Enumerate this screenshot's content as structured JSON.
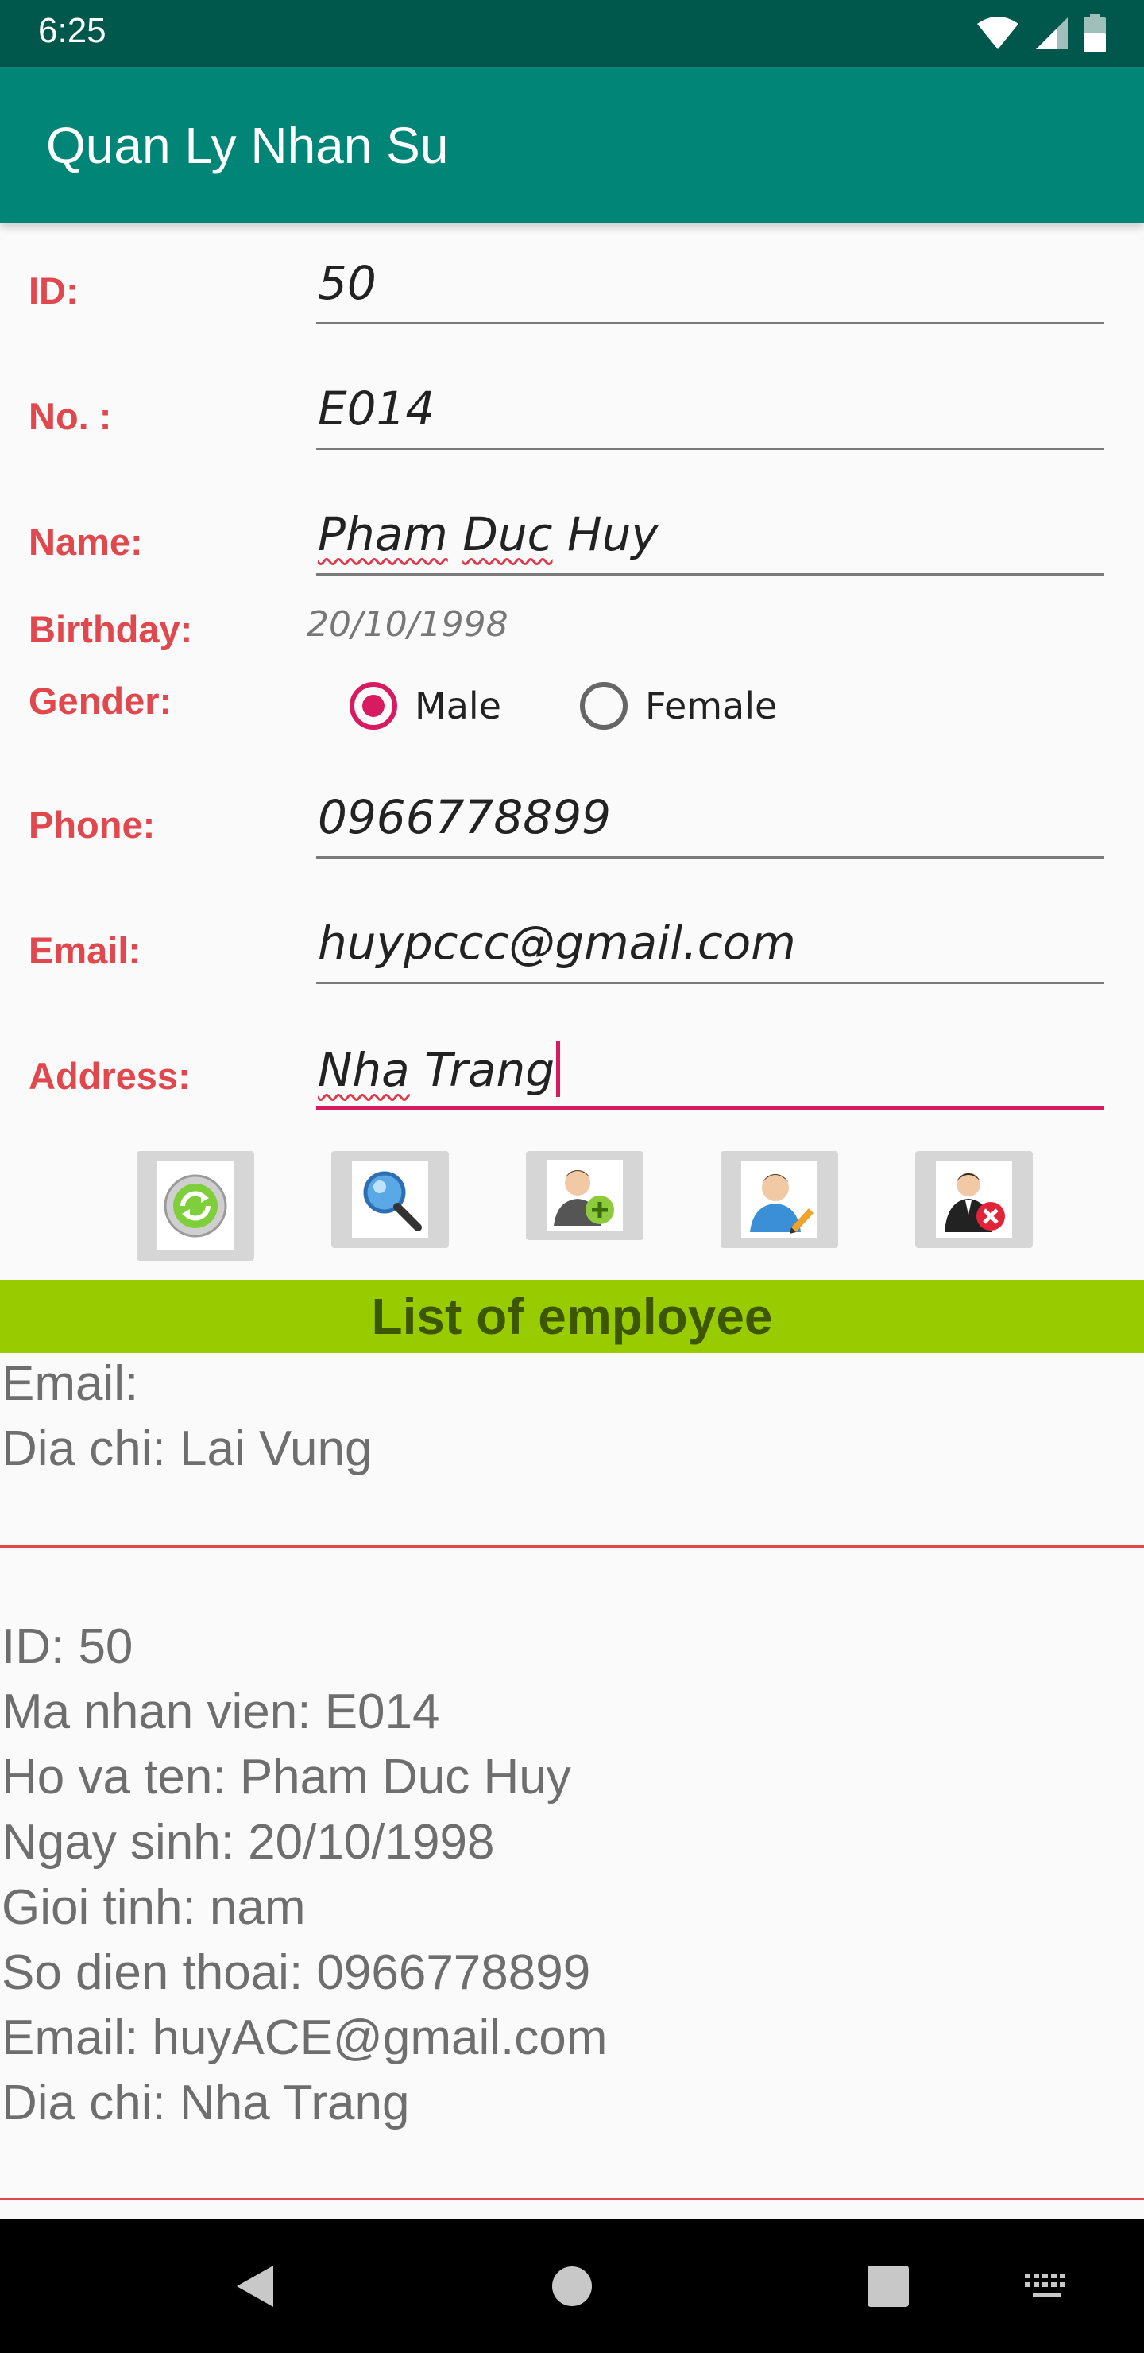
{
  "status_bar": {
    "time": "6:25",
    "icons": [
      "wifi-icon",
      "signal-icon",
      "battery-icon"
    ]
  },
  "app_bar": {
    "title": "Quan Ly Nhan Su"
  },
  "form": {
    "id_label": "ID:",
    "id_value": "50",
    "no_label": "No. :",
    "no_value": "E014",
    "name_label": "Name:",
    "name_word1": "Pham",
    "name_word2": "Duc",
    "name_word3": "Huy",
    "birthday_label": "Birthday:",
    "birthday_value": "20/10/1998",
    "gender_label": "Gender:",
    "gender_male": "Male",
    "gender_female": "Female",
    "gender_selected": "Male",
    "phone_label": "Phone:",
    "phone_value": "0966778899",
    "email_label": "Email:",
    "email_value": "huypccc@gmail.com",
    "address_label": "Address:",
    "address_word1": "Nha",
    "address_word2": "Trang"
  },
  "actions": [
    {
      "icon": "refresh-icon"
    },
    {
      "icon": "search-icon"
    },
    {
      "icon": "add-user-icon"
    },
    {
      "icon": "edit-user-icon"
    },
    {
      "icon": "delete-user-icon"
    }
  ],
  "list": {
    "header": "List of employee",
    "partial_record": {
      "email": "Email:",
      "address": "Dia chi: Lai Vung"
    },
    "record": {
      "id": "ID: 50",
      "code": "Ma nhan vien: E014",
      "name": "Ho va ten: Pham Duc Huy",
      "birthday": "Ngay sinh: 20/10/1998",
      "gender": "Gioi tinh: nam",
      "phone": "So dien thoai: 0966778899",
      "email": "Email: huyACE@gmail.com",
      "address": "Dia chi: Nha Trang"
    }
  },
  "colors": {
    "status_bar": "#00574b",
    "app_bar": "#008577",
    "label": "#e0484d",
    "accent": "#d81b60",
    "list_header": "#99cc00"
  }
}
